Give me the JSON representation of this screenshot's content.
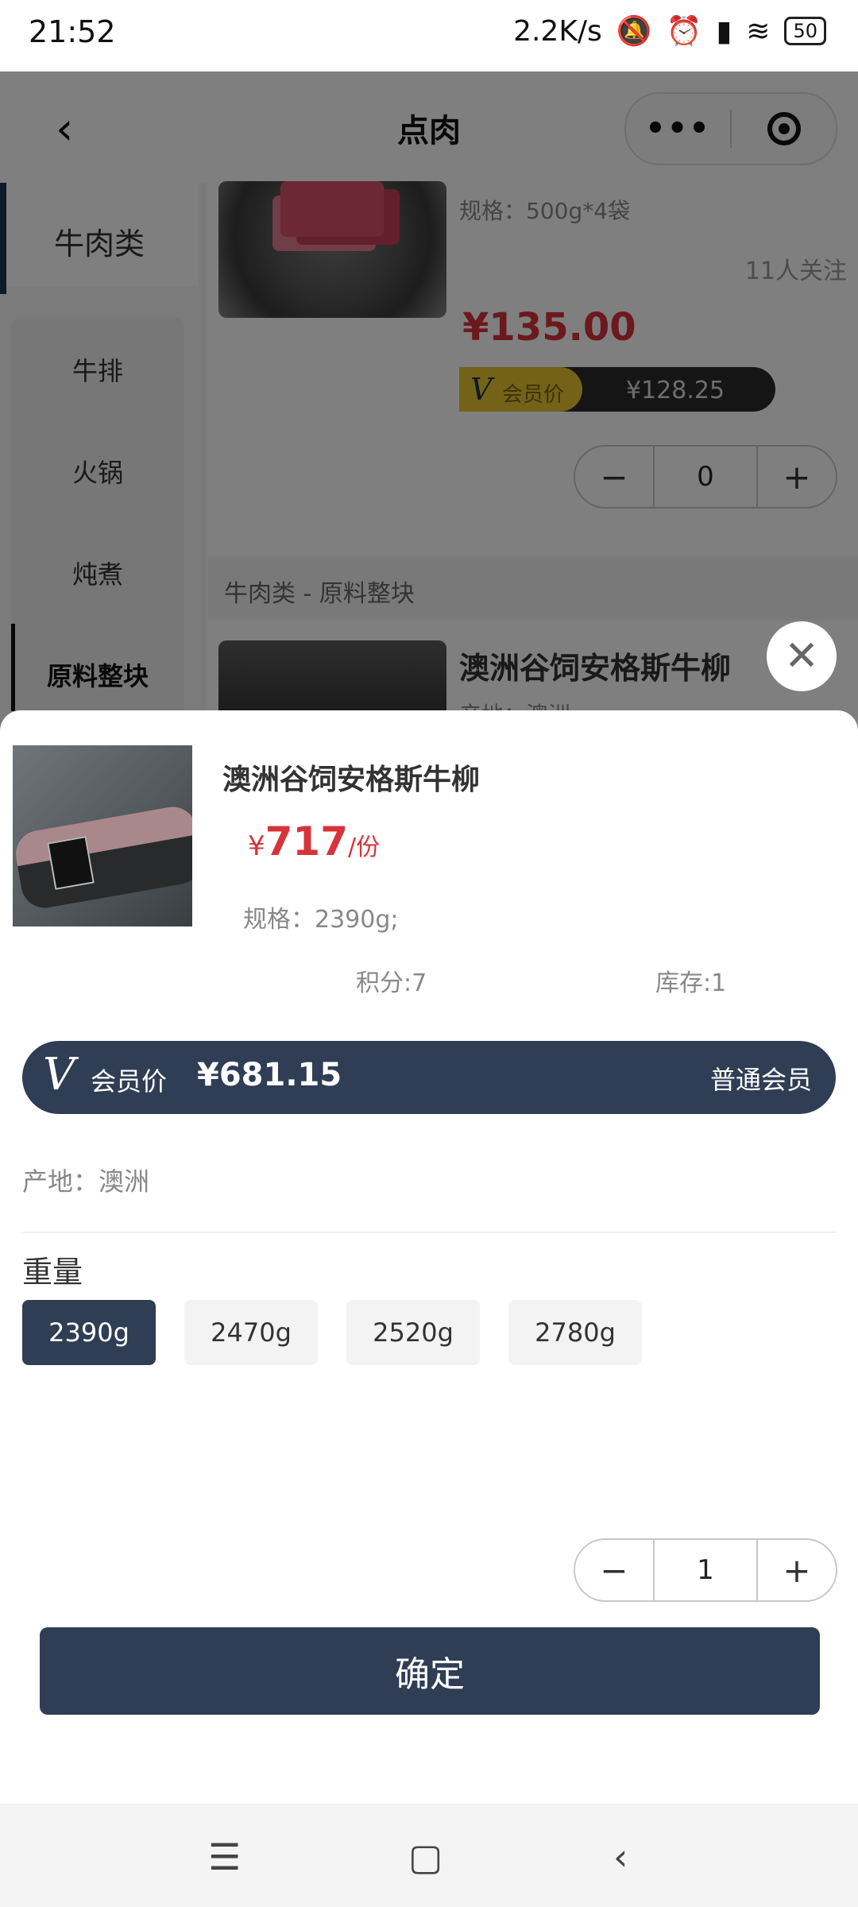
{
  "status": {
    "time": "21:52",
    "speed": "2.2K/s",
    "battery": "50"
  },
  "header": {
    "back_icon": "chevron-left-icon",
    "title": "点肉",
    "more_icon": "more-dots-icon",
    "target_icon": "record-icon"
  },
  "sidebar": {
    "category": "牛肉类",
    "subcategories": [
      "牛排",
      "火锅",
      "炖煮",
      "原料整块"
    ],
    "selected": "原料整块"
  },
  "list": {
    "item1": {
      "spec": "规格：500g*4袋",
      "followers": "11人关注",
      "price": "¥135.00",
      "member_label": "会员价",
      "member_price": "¥128.25",
      "qty": "0"
    },
    "section_title": "牛肉类 - 原料整块",
    "item2": {
      "name": "澳洲谷饲安格斯牛柳",
      "origin": "产地：澳洲"
    }
  },
  "detail": {
    "name": "澳洲谷饲安格斯牛柳",
    "currency": "¥",
    "price": "717",
    "unit": "/份",
    "spec": "规格：2390g;",
    "points": "积分:7",
    "stock": "库存:1",
    "member_label": "会员价",
    "member_price": "¥681.15",
    "member_level": "普通会员",
    "origin": "产地：澳洲",
    "weight_label": "重量",
    "weight_options": [
      "2390g",
      "2470g",
      "2520g",
      "2780g"
    ],
    "selected_weight": "2390g",
    "qty": "1",
    "confirm": "确定"
  },
  "colors": {
    "accent": "#2f3d55",
    "price_red": "#d7333b",
    "gold": "#e7c430"
  }
}
